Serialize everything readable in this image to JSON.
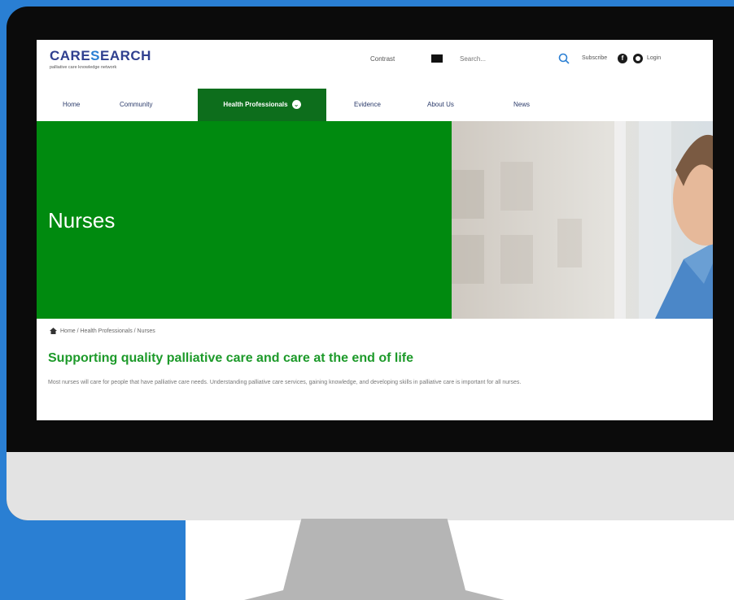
{
  "header": {
    "logo_text_main": "CARE",
    "logo_text_accent": "S",
    "logo_text_rest": "EARCH",
    "logo_tagline": "palliative care knowledge network",
    "contrast_label": "Contrast",
    "search_placeholder": "Search...",
    "subscribe_label": "Subscribe",
    "login_label": "Login"
  },
  "nav": {
    "items": [
      {
        "label": "Home"
      },
      {
        "label": "Community"
      },
      {
        "label": "Health Professionals"
      },
      {
        "label": "Evidence"
      },
      {
        "label": "About Us"
      },
      {
        "label": "News"
      }
    ],
    "active_index": 2
  },
  "hero": {
    "title": "Nurses"
  },
  "content": {
    "breadcrumb": "Home / Health Professionals / Nurses",
    "heading": "Supporting quality palliative care and care at the end of life",
    "intro": "Most nurses will care for people that have palliative care needs. Understanding palliative care services, gaining knowledge, and developing skills in palliative care is important for all nurses."
  },
  "colors": {
    "background": "#2a7fd3",
    "brand_green": "#008a0f",
    "nav_active": "#0d6e1c",
    "heading_green": "#1d9a2a",
    "logo_blue": "#2f3f8f"
  },
  "icons": [
    "search-icon",
    "facebook-icon",
    "user-icon",
    "home-icon",
    "chevron-down-icon"
  ]
}
